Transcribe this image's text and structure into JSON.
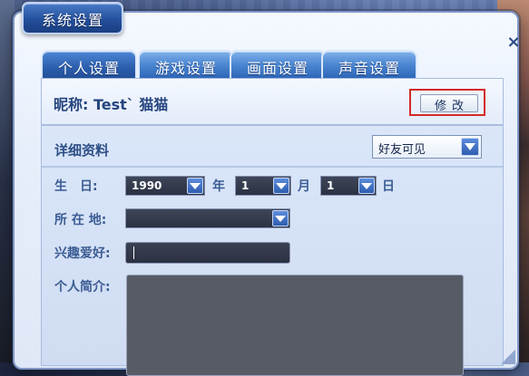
{
  "window": {
    "title": "系统设置",
    "close_symbol": "×"
  },
  "tabs": [
    {
      "label": "个人设置",
      "active": true
    },
    {
      "label": "游戏设置",
      "active": false
    },
    {
      "label": "画面设置",
      "active": false
    },
    {
      "label": "声音设置",
      "active": false
    }
  ],
  "profile": {
    "nickname_text": "昵称: Test` 猫猫",
    "modify_button": "修改"
  },
  "details": {
    "title": "详细资料",
    "privacy": {
      "selected": "好友可见"
    },
    "birthday": {
      "label": "生　日:",
      "year": "1990",
      "year_unit": "年",
      "month": "1",
      "month_unit": "月",
      "day": "1",
      "day_unit": "日"
    },
    "location": {
      "label": "所 在 地:",
      "value": ""
    },
    "hobbies": {
      "label": "兴趣爱好:",
      "value": ""
    },
    "intro": {
      "label": "个人简介:",
      "value": ""
    }
  },
  "colors": {
    "accent_red": "#d32a2a",
    "tab_blue": "#2e67b8",
    "label_blue": "#3b5c93"
  }
}
